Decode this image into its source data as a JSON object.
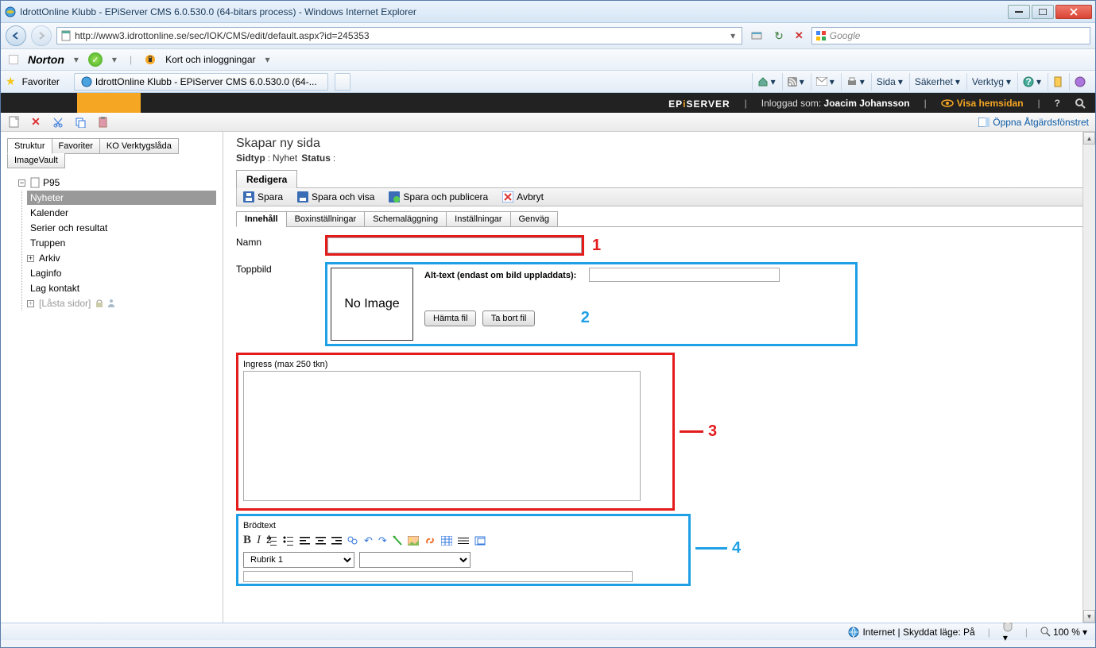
{
  "window": {
    "title": "IdrottOnline Klubb - EPiServer CMS 6.0.530.0 (64-bitars process) - Windows Internet Explorer"
  },
  "address": {
    "url": "http://www3.idrottonline.se/sec/IOK/CMS/edit/default.aspx?id=245353"
  },
  "search": {
    "placeholder": "Google"
  },
  "norton": {
    "brand": "Norton",
    "login_label": "Kort och inloggningar"
  },
  "favorites": {
    "label": "Favoriter",
    "tab_title": "IdrottOnline Klubb - EPiServer CMS 6.0.530.0 (64-..."
  },
  "ie_toolbar": {
    "page": "Sida",
    "safety": "Säkerhet",
    "tools": "Verktyg"
  },
  "episerver": {
    "brand_pre": "EP",
    "brand_i": "i",
    "brand_post": "SERVER",
    "logged_in_label": "Inloggad som:",
    "user": "Joacim Johansson",
    "view_site": "Visa hemsidan"
  },
  "action_panel": {
    "open": "Öppna Åtgärdsfönstret"
  },
  "left_tabs": {
    "struktur": "Struktur",
    "favoriter": "Favoriter",
    "verktyg": "KO Verktygslåda",
    "imagevault": "ImageVault"
  },
  "tree": {
    "root": "P95",
    "nyheter": "Nyheter",
    "kalender": "Kalender",
    "serier": "Serier och resultat",
    "truppen": "Truppen",
    "arkiv": "Arkiv",
    "laginfo": "Laginfo",
    "lagkontakt": "Lag kontakt",
    "locked": "[Låsta sidor]"
  },
  "page": {
    "title": "Skapar ny sida",
    "type_label": "Sidtyp",
    "type_value": "Nyhet",
    "status_label": "Status",
    "edit_tab": "Redigera"
  },
  "actions": {
    "spara": "Spara",
    "spara_visa": "Spara och visa",
    "spara_pub": "Spara och publicera",
    "avbryt": "Avbryt"
  },
  "content_tabs": {
    "innehall": "Innehåll",
    "box": "Boxinställningar",
    "schema": "Schemaläggning",
    "install": "Inställningar",
    "genvag": "Genväg"
  },
  "form": {
    "namn": "Namn",
    "toppbild": "Toppbild",
    "noimage": "No Image",
    "alt_text": "Alt-text (endast om bild uppladdats):",
    "hamta": "Hämta fil",
    "tabort": "Ta bort fil",
    "ingress": "Ingress (max 250 tkn)",
    "brodtext": "Brödtext",
    "heading": "Rubrik 1"
  },
  "annotations": {
    "n1": "1",
    "n2": "2",
    "n3": "3",
    "n4": "4"
  },
  "status": {
    "mode": "Internet | Skyddat läge: På",
    "zoom": "100 %"
  }
}
